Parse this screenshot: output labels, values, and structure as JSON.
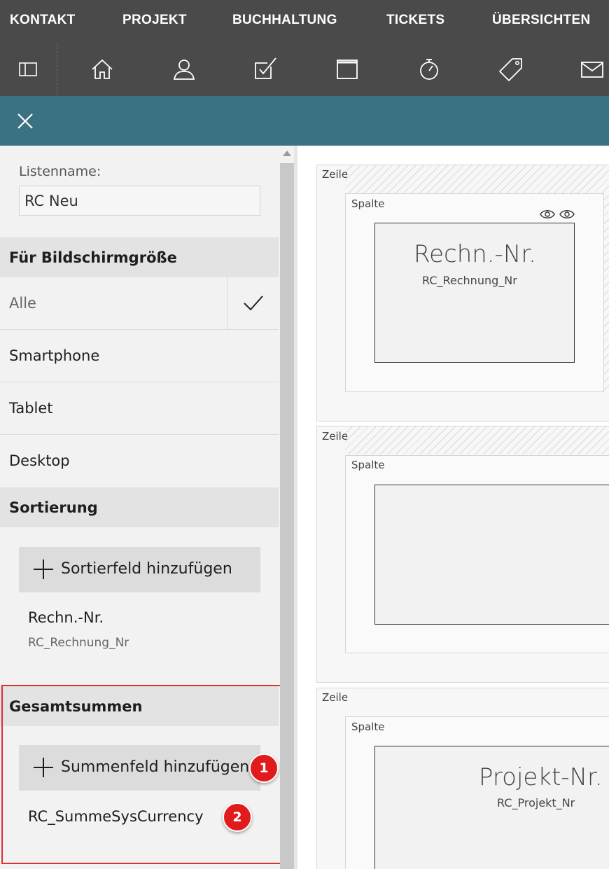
{
  "menu": [
    "KONTAKT",
    "PROJEKT",
    "BUCHHALTUNG",
    "TICKETS",
    "ÜBERSICHTEN"
  ],
  "toolbar_icons": [
    "sidebar-toggle-icon",
    "home-icon",
    "user-icon",
    "task-check-icon",
    "window-icon",
    "timer-icon",
    "tag-icon",
    "mail-icon"
  ],
  "colors": {
    "topbar": "#4a4a4a",
    "teal": "#3b7283",
    "badge": "#e11b1b",
    "highlight": "#d83232"
  },
  "left": {
    "listname_label": "Listenname:",
    "listname_value": "RC Neu",
    "screen_section": "Für Bildschirmgröße",
    "screen_options": [
      "Alle",
      "Smartphone",
      "Tablet",
      "Desktop"
    ],
    "screen_selected": "Alle",
    "sort_section": "Sortierung",
    "sort_add_button": "Sortierfeld hinzufügen",
    "sort_field": {
      "title": "Rechn.-Nr.",
      "sub": "RC_Rechnung_Nr"
    },
    "totals_section": "Gesamtsummen",
    "totals_add_button": "Summenfeld hinzufügen",
    "totals_field": "RC_SummeSysCurrency",
    "badges": [
      "1",
      "2"
    ]
  },
  "canvas": {
    "row_label": "Zeile",
    "col_label": "Spalte",
    "cards": [
      {
        "title": "Rechn.-Nr.",
        "sub": "RC_Rechnung_Nr"
      },
      {
        "title": "",
        "sub": ""
      },
      {
        "title": "Projekt-Nr.",
        "sub": "RC_Projekt_Nr"
      }
    ]
  }
}
